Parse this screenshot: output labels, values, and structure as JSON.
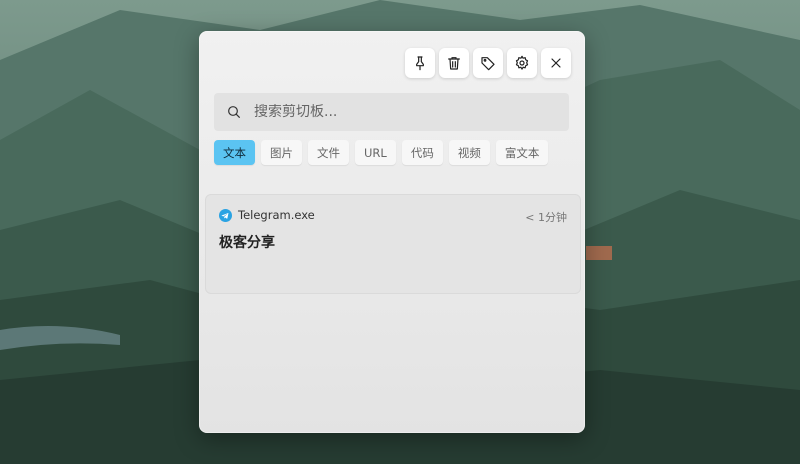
{
  "toolbar": {
    "pin_icon": "pin-icon",
    "delete_icon": "trash-icon",
    "tag_icon": "tag-icon",
    "settings_icon": "gear-icon",
    "close_icon": "close-icon"
  },
  "search": {
    "placeholder": "搜索剪切板...",
    "value": ""
  },
  "tabs": [
    {
      "label": "文本",
      "active": true
    },
    {
      "label": "图片",
      "active": false
    },
    {
      "label": "文件",
      "active": false
    },
    {
      "label": "URL",
      "active": false
    },
    {
      "label": "代码",
      "active": false
    },
    {
      "label": "视频",
      "active": false
    },
    {
      "label": "富文本",
      "active": false
    }
  ],
  "items": [
    {
      "source_icon": "telegram-icon",
      "source_app": "Telegram.exe",
      "time": "< 1分钟",
      "content": "极客分享"
    }
  ],
  "colors": {
    "active_tab": "#5bc4f2",
    "telegram": "#2aa3e3"
  }
}
